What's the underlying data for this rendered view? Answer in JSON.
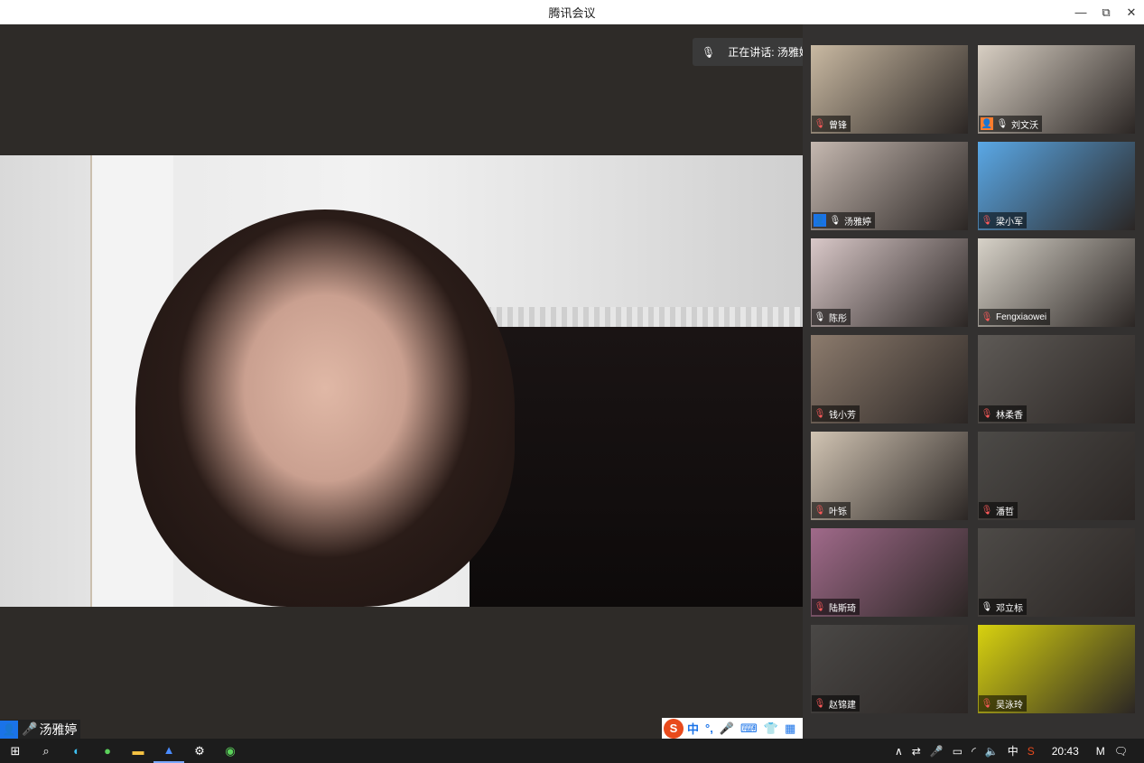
{
  "window": {
    "title": "腾讯会议"
  },
  "speaking": {
    "text": "正在讲话: 汤雅婷;"
  },
  "self": {
    "name": "汤雅婷"
  },
  "ime": {
    "lang": "中",
    "punct": "°,"
  },
  "participants": [
    {
      "name": "曾锋",
      "mic": "muted",
      "bg": "#c9b9a2"
    },
    {
      "name": "刘文沃",
      "mic": "on",
      "owner": true,
      "bg": "#d8cfc3"
    },
    {
      "name": "汤雅婷",
      "mic": "on",
      "host": true,
      "active": true,
      "bg": "#c5b8b0"
    },
    {
      "name": "梁小军",
      "mic": "muted",
      "bg": "#5aa8e6"
    },
    {
      "name": "陈彤",
      "mic": "on",
      "bg": "#d9c8c8"
    },
    {
      "name": "Fengxiaowei",
      "mic": "muted",
      "bg": "#d7d2c8"
    },
    {
      "name": "钱小芳",
      "mic": "muted",
      "bg": "#8c7b6d"
    },
    {
      "name": "林柔香",
      "mic": "muted",
      "bg": "#5e5a56"
    },
    {
      "name": "叶铄",
      "mic": "muted",
      "bg": "#d1c4b3"
    },
    {
      "name": "潘哲",
      "mic": "muted",
      "bg": "#4c4a47"
    },
    {
      "name": "陆斯琦",
      "mic": "muted",
      "bg": "#a06a8a"
    },
    {
      "name": "邓立标",
      "mic": "on",
      "bg": "#4d4a47"
    },
    {
      "name": "赵锦建",
      "mic": "muted",
      "bg": "#4a4846"
    },
    {
      "name": "吴泳玲",
      "mic": "muted",
      "bg": "#d8d20f"
    }
  ],
  "taskbar": {
    "time": "20:43",
    "ime": "中"
  },
  "icons": {
    "minimize": "minimize-icon",
    "restore": "restore-icon",
    "close": "close-icon",
    "mic": "microphone-icon",
    "mic_muted": "microphone-muted-icon"
  }
}
